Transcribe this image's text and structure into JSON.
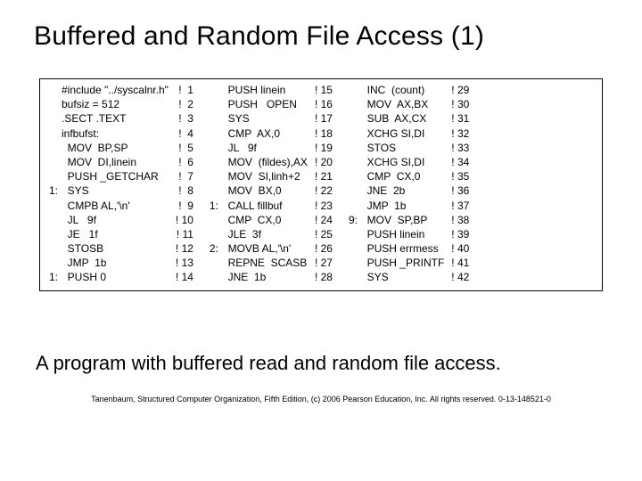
{
  "title": "Buffered and Random File Access (1)",
  "caption": "A program with buffered read and random file access.",
  "credit": "Tanenbaum, Structured Computer Organization, Fifth Edition, (c) 2006 Pearson Education, Inc. All rights reserved. 0-13-148521-0",
  "code": {
    "col1": {
      "labels": "\n\n\n\n\n\n\n1:\n\n\n\n\n\n1:",
      "instr": "#include \"../syscalnr.h\"\nbufsiz = 512\n.SECT .TEXT\ninfbufst:\n  MOV  BP,SP\n  MOV  DI,linein\n  PUSH _GETCHAR\n  SYS\n  CMPB AL,'\\n'\n  JL   9f\n  JE   1f\n  STOSB\n  JMP  1b\n  PUSH 0",
      "nums": "!  1\n!  2\n!  3\n!  4\n!  5\n!  6\n!  7\n!  8\n!  9\n! 10\n! 11\n! 12\n! 13\n! 14"
    },
    "col2": {
      "labels": "\n\n\n\n\n\n\n\n1:\n\n\n2:\n\n",
      "instr": "  PUSH linein\n  PUSH   OPEN\n  SYS\n  CMP  AX,0\n  JL   9f\n  MOV  (fildes),AX\n  MOV  SI,linh+2\n  MOV  BX,0\n  CALL fillbuf\n  CMP  CX,0\n  JLE  3f\n  MOVB AL,'\\n'\n  REPNE  SCASB\n  JNE  1b",
      "nums": "! 15\n! 16\n! 17\n! 18\n! 19\n! 20\n! 21\n! 22\n! 23\n! 24\n! 25\n! 26\n! 27\n! 28"
    },
    "col3": {
      "labels": "\n\n\n\n\n\n\n\n\n9:\n\n\n\n",
      "instr": "  INC  (count)\n  MOV  AX,BX\n  SUB  AX,CX\n  XCHG SI,DI\n  STOS\n  XCHG SI,DI\n  CMP  CX,0\n  JNE  2b\n  JMP  1b\n  MOV  SP,BP\n  PUSH linein\n  PUSH errmess\n  PUSH _PRINTF\n  SYS",
      "nums": "! 29\n! 30\n! 31\n! 32\n! 33\n! 34\n! 35\n! 36\n! 37\n! 38\n! 39\n! 40\n! 41\n! 42"
    }
  }
}
